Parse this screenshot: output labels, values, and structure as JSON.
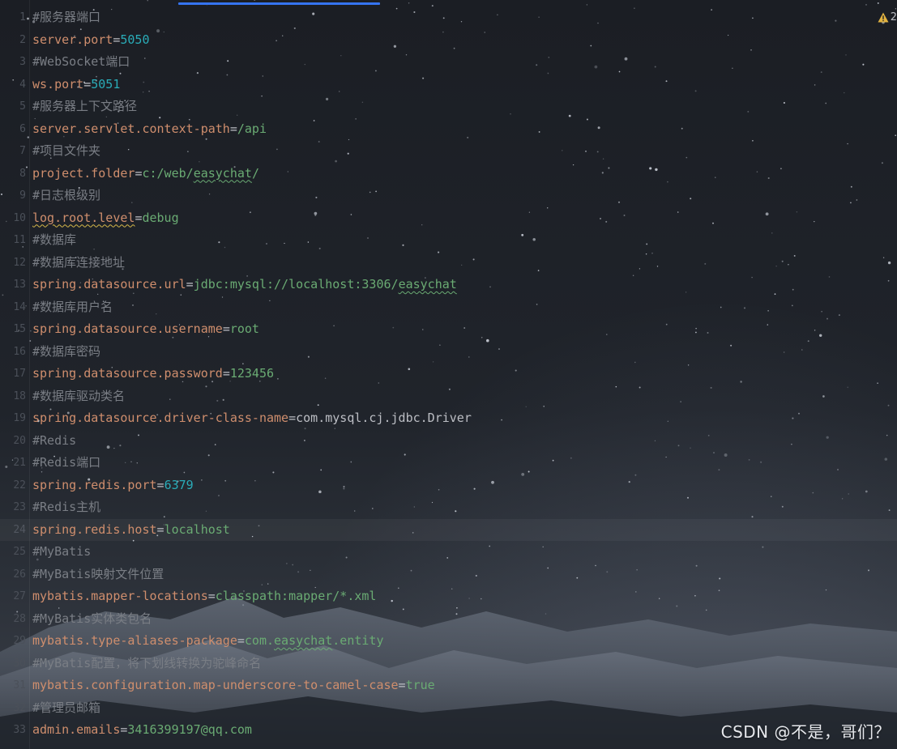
{
  "editor": {
    "warning_count": "2",
    "lines": [
      {
        "number": "1",
        "parts": [
          {
            "t": "#服务器端口",
            "c": "cmt"
          }
        ]
      },
      {
        "number": "2",
        "parts": [
          {
            "t": "server.port",
            "c": "key"
          },
          {
            "t": "=",
            "c": "eq"
          },
          {
            "t": "5050",
            "c": "num"
          }
        ]
      },
      {
        "number": "3",
        "parts": [
          {
            "t": "#WebSocket端口",
            "c": "cmt"
          }
        ]
      },
      {
        "number": "4",
        "parts": [
          {
            "t": "ws.port",
            "c": "key"
          },
          {
            "t": "=",
            "c": "eq"
          },
          {
            "t": "5051",
            "c": "num"
          }
        ]
      },
      {
        "number": "5",
        "parts": [
          {
            "t": "#服务器上下文路径",
            "c": "cmt"
          }
        ]
      },
      {
        "number": "6",
        "parts": [
          {
            "t": "server.servlet.context-path",
            "c": "key"
          },
          {
            "t": "=",
            "c": "eq"
          },
          {
            "t": "/api",
            "c": "val"
          }
        ]
      },
      {
        "number": "7",
        "parts": [
          {
            "t": "#项目文件夹",
            "c": "cmt"
          }
        ]
      },
      {
        "number": "8",
        "parts": [
          {
            "t": "project.folder",
            "c": "key"
          },
          {
            "t": "=",
            "c": "eq"
          },
          {
            "t": "c:/web/",
            "c": "val"
          },
          {
            "t": "easychat",
            "c": "val squiggle"
          },
          {
            "t": "/",
            "c": "val"
          }
        ]
      },
      {
        "number": "9",
        "parts": [
          {
            "t": "#日志根级别",
            "c": "cmt"
          }
        ]
      },
      {
        "number": "10",
        "parts": [
          {
            "t": "log.root.level",
            "c": "key squiggle-warn"
          },
          {
            "t": "=",
            "c": "eq"
          },
          {
            "t": "debug",
            "c": "val"
          }
        ]
      },
      {
        "number": "11",
        "parts": [
          {
            "t": "#数据库",
            "c": "cmt"
          }
        ]
      },
      {
        "number": "12",
        "parts": [
          {
            "t": "#数据库连接地址",
            "c": "cmt"
          }
        ]
      },
      {
        "number": "13",
        "parts": [
          {
            "t": "spring.datasource.url",
            "c": "key"
          },
          {
            "t": "=",
            "c": "eq"
          },
          {
            "t": "jdbc:mysql://localhost:3306/",
            "c": "val"
          },
          {
            "t": "easychat",
            "c": "val squiggle"
          }
        ]
      },
      {
        "number": "14",
        "parts": [
          {
            "t": "#数据库用户名",
            "c": "cmt"
          }
        ]
      },
      {
        "number": "15",
        "parts": [
          {
            "t": "spring.datasource.username",
            "c": "key"
          },
          {
            "t": "=",
            "c": "eq"
          },
          {
            "t": "root",
            "c": "val"
          }
        ]
      },
      {
        "number": "16",
        "parts": [
          {
            "t": "#数据库密码",
            "c": "cmt"
          }
        ]
      },
      {
        "number": "17",
        "parts": [
          {
            "t": "spring.datasource.password",
            "c": "key"
          },
          {
            "t": "=",
            "c": "eq"
          },
          {
            "t": "123456",
            "c": "val"
          }
        ]
      },
      {
        "number": "18",
        "parts": [
          {
            "t": "#数据库驱动类名",
            "c": "cmt"
          }
        ]
      },
      {
        "number": "19",
        "parts": [
          {
            "t": "spring.datasource.driver-class-name",
            "c": "key"
          },
          {
            "t": "=",
            "c": "eq"
          },
          {
            "t": "com.mysql.cj.jdbc.Driver",
            "c": "plain"
          }
        ]
      },
      {
        "number": "20",
        "parts": [
          {
            "t": "#Redis",
            "c": "cmt"
          }
        ]
      },
      {
        "number": "21",
        "parts": [
          {
            "t": "#Redis端口",
            "c": "cmt"
          }
        ]
      },
      {
        "number": "22",
        "parts": [
          {
            "t": "spring.redis.port",
            "c": "key"
          },
          {
            "t": "=",
            "c": "eq"
          },
          {
            "t": "6379",
            "c": "num"
          }
        ]
      },
      {
        "number": "23",
        "parts": [
          {
            "t": "#Redis主机",
            "c": "cmt"
          }
        ]
      },
      {
        "number": "24",
        "current": true,
        "parts": [
          {
            "t": "spring.redis.host",
            "c": "key"
          },
          {
            "t": "=",
            "c": "eq"
          },
          {
            "t": "localhost",
            "c": "val"
          }
        ]
      },
      {
        "number": "25",
        "parts": [
          {
            "t": "#MyBatis",
            "c": "cmt"
          }
        ]
      },
      {
        "number": "26",
        "parts": [
          {
            "t": "#MyBatis映射文件位置",
            "c": "cmt"
          }
        ]
      },
      {
        "number": "27",
        "parts": [
          {
            "t": "mybatis.mapper-locations",
            "c": "key"
          },
          {
            "t": "=",
            "c": "eq"
          },
          {
            "t": "classpath:mapper/*.xml",
            "c": "val"
          }
        ]
      },
      {
        "number": "28",
        "parts": [
          {
            "t": "#MyBatis实体类包名",
            "c": "cmt"
          }
        ]
      },
      {
        "number": "29",
        "parts": [
          {
            "t": "mybatis.type-aliases-package",
            "c": "key"
          },
          {
            "t": "=",
            "c": "eq"
          },
          {
            "t": "com.",
            "c": "val"
          },
          {
            "t": "easychat",
            "c": "val squiggle"
          },
          {
            "t": ".entity",
            "c": "val"
          }
        ]
      },
      {
        "number": "30",
        "parts": [
          {
            "t": "#MyBatis配置，将下划线转换为驼峰命名",
            "c": "cmt"
          }
        ]
      },
      {
        "number": "31",
        "parts": [
          {
            "t": "mybatis.configuration.map-underscore-to-camel-case",
            "c": "key"
          },
          {
            "t": "=",
            "c": "eq"
          },
          {
            "t": "true",
            "c": "val"
          }
        ]
      },
      {
        "number": "32",
        "parts": [
          {
            "t": "#管理员邮箱",
            "c": "cmt"
          }
        ]
      },
      {
        "number": "33",
        "parts": [
          {
            "t": "admin.emails",
            "c": "key"
          },
          {
            "t": "=",
            "c": "eq"
          },
          {
            "t": "3416399197@qq.com",
            "c": "val"
          }
        ]
      }
    ]
  },
  "watermark": "CSDN @不是，哥们？",
  "colors": {
    "comment": "#7a7e85",
    "key": "#cf8e6d",
    "value": "#6aab73",
    "number": "#2aacb8",
    "plain": "#bcbec4",
    "tab_accent": "#3574f0",
    "warning": "#e2b340"
  }
}
